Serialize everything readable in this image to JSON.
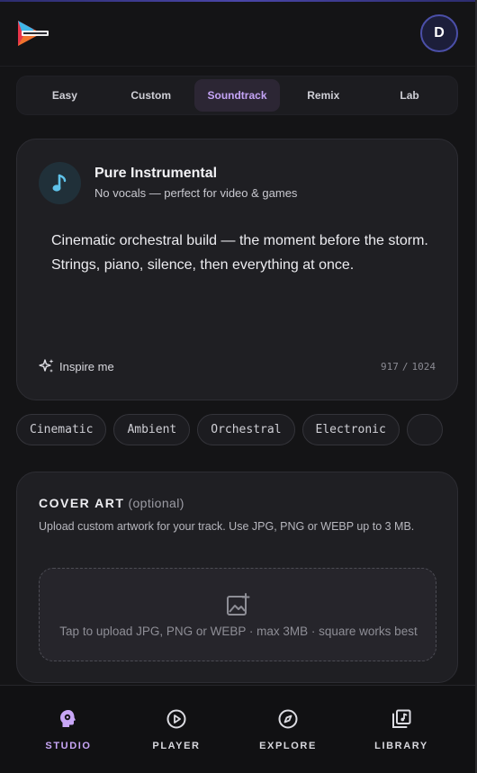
{
  "header": {
    "logo_icon": "play-logo-icon",
    "avatar_initial": "D"
  },
  "tabs": [
    {
      "label": "Easy",
      "active": false
    },
    {
      "label": "Custom",
      "active": false
    },
    {
      "label": "Soundtrack",
      "active": true
    },
    {
      "label": "Remix",
      "active": false
    },
    {
      "label": "Lab",
      "active": false
    }
  ],
  "prompt_card": {
    "icon": "music-note-icon",
    "title": "Pure Instrumental",
    "subtitle": "No vocals — perfect for video & games",
    "prompt_text": "Cinematic orchestral build — the moment before the storm. Strings, piano, silence, then everything at once.",
    "inspire_label": "Inspire me",
    "char_count": "917",
    "char_limit": "1024",
    "counter_separator": "/"
  },
  "genre_chips": [
    "Cinematic",
    "Ambient",
    "Orchestral",
    "Electronic"
  ],
  "cover_art": {
    "title": "COVER ART",
    "optional_label": "(optional)",
    "description": "Upload custom artwork for your track. Use JPG, PNG or WEBP up to 3 MB.",
    "dropzone_text": "Tap to upload JPG, PNG or WEBP · max 3MB · square works best",
    "dropzone_icon": "image-add-icon"
  },
  "bottom_nav": [
    {
      "label": "STUDIO",
      "icon": "studio-head-icon",
      "active": true
    },
    {
      "label": "PLAYER",
      "icon": "play-circle-icon",
      "active": false
    },
    {
      "label": "EXPLORE",
      "icon": "compass-icon",
      "active": false
    },
    {
      "label": "LIBRARY",
      "icon": "library-icon",
      "active": false
    }
  ],
  "colors": {
    "accent": "#c8a6f6",
    "active_tab_bg": "#2c2634",
    "avatar_border": "#4b4fa8",
    "music_icon": "#5fc3ea"
  }
}
